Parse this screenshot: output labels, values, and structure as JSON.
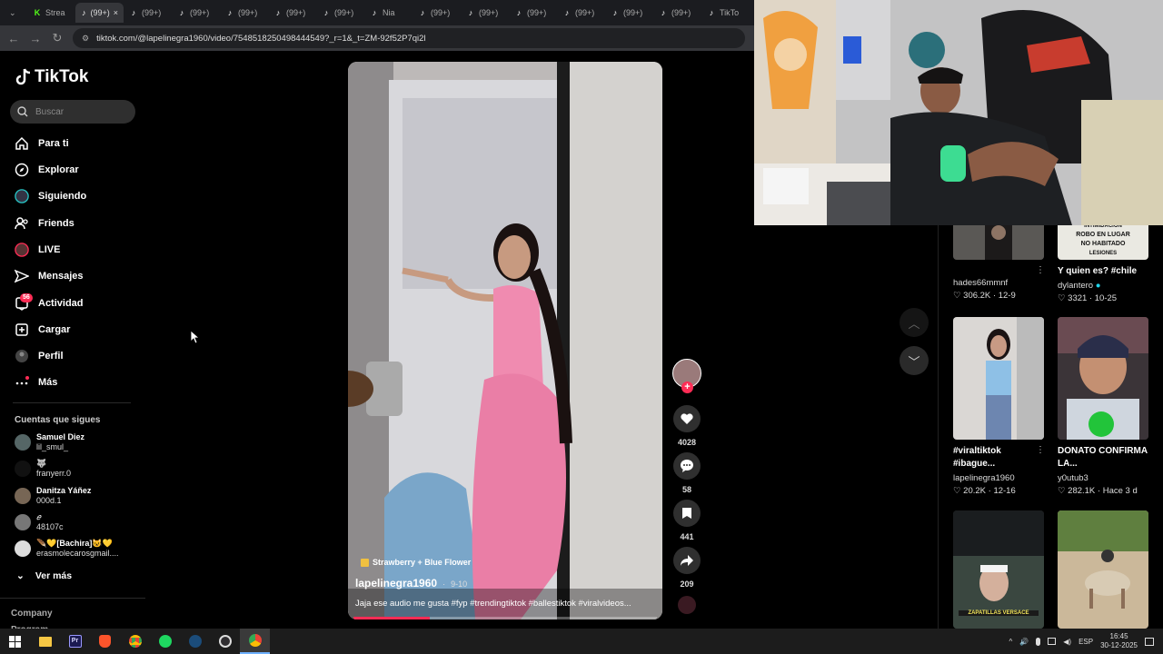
{
  "browser": {
    "tabs": [
      "Strea",
      "(99+)",
      "(99+)",
      "(99+)",
      "(99+)",
      "(99+)",
      "(99+)",
      "Nia",
      "(99+)",
      "(99+)",
      "(99+)",
      "(99+)",
      "(99+)",
      "(99+)",
      "TikTo"
    ],
    "url": "tiktok.com/@lapelinegra1960/video/7548518250498444549?_r=1&_t=ZM-92f52P7qi2l"
  },
  "sidebar": {
    "logo": "TikTok",
    "search_placeholder": "Buscar",
    "nav": [
      "Para ti",
      "Explorar",
      "Siguiendo",
      "Friends",
      "LIVE",
      "Mensajes",
      "Actividad",
      "Cargar",
      "Perfil",
      "Más"
    ],
    "activity_badge": "56",
    "following_title": "Cuentas que sigues",
    "following": [
      {
        "name": "Samuel Diez",
        "handle": "lil_smul_"
      },
      {
        "name": "🐺",
        "handle": "franyerr.0"
      },
      {
        "name": "Danitza Yáñez",
        "handle": "000d.1"
      },
      {
        "name": "𝑒",
        "handle": "48107c"
      },
      {
        "name": "🪶💛[Bachira]😺💛",
        "handle": "erasmolecarosgmail...."
      }
    ],
    "see_more": "Ver más",
    "company": "Company",
    "program": "Program"
  },
  "video": {
    "music": "Strawberry + Blue Flower",
    "author": "lapelinegra1960",
    "date": "9-10",
    "caption": "Jaja ese audio me gusta #fyp #trendingtiktok #ballestiktok #viralvideos...",
    "likes": "4028",
    "comments": "58",
    "saves": "441",
    "shares": "209"
  },
  "grid": [
    {
      "title": "",
      "author": "hades66mmnf",
      "likes": "306.2K",
      "date": "12-9"
    },
    {
      "title": "Y quien es? #chile",
      "author": "dylantero",
      "likes": "3321",
      "date": "10-25"
    },
    {
      "title": "#viraltiktok #ibague...",
      "author": "lapelinegra1960",
      "likes": "20.2K",
      "date": "12-16"
    },
    {
      "title": "DONATO CONFIRMA LA...",
      "author": "y0utub3",
      "likes": "282.1K",
      "date": "Hace 3 d"
    }
  ],
  "thumb_texts": {
    "robbery_line1": "ROBO EN LUGAR",
    "robbery_line2": "NO HABITADO",
    "robbery_top": "INTIMIDACION",
    "robbery_bottom": "LESIONES",
    "zapatillas": "ZAPATILLAS VERSACE"
  },
  "taskbar": {
    "lang": "ESP",
    "time": "16:45",
    "date": "30-12-2025"
  },
  "colors": {
    "accent": "#fe2c55",
    "bg": "#000000"
  }
}
